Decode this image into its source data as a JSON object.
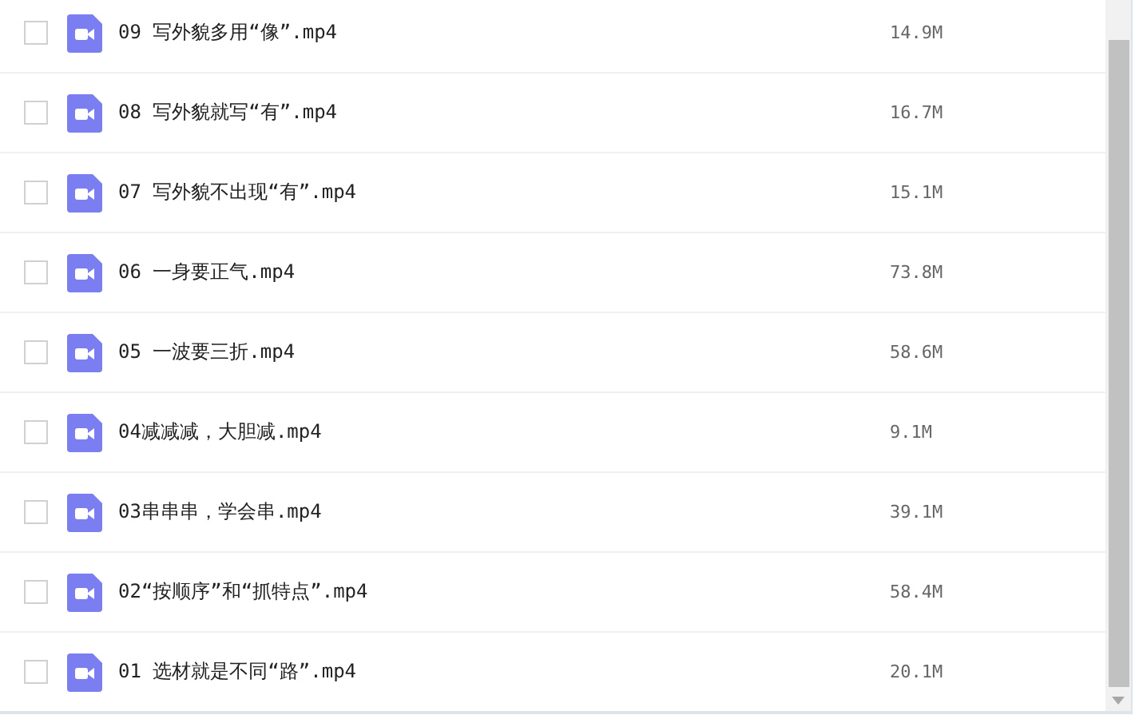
{
  "files": [
    {
      "name": "09 写外貌多用“像”.mp4",
      "size": "14.9M",
      "checked": false
    },
    {
      "name": "08 写外貌就写“有”.mp4",
      "size": "16.7M",
      "checked": false
    },
    {
      "name": "07 写外貌不出现“有”.mp4",
      "size": "15.1M",
      "checked": false
    },
    {
      "name": "06 一身要正气.mp4",
      "size": "73.8M",
      "checked": false
    },
    {
      "name": "05 一波要三折.mp4",
      "size": "58.6M",
      "checked": false
    },
    {
      "name": "04减减减，大胆减.mp4",
      "size": "9.1M",
      "checked": false
    },
    {
      "name": "03串串串，学会串.mp4",
      "size": "39.1M",
      "checked": false
    },
    {
      "name": "02“按顺序”和“抓特点”.mp4",
      "size": "58.4M",
      "checked": false
    },
    {
      "name": "01 选材就是不同“路”.mp4",
      "size": "20.1M",
      "checked": false
    }
  ]
}
